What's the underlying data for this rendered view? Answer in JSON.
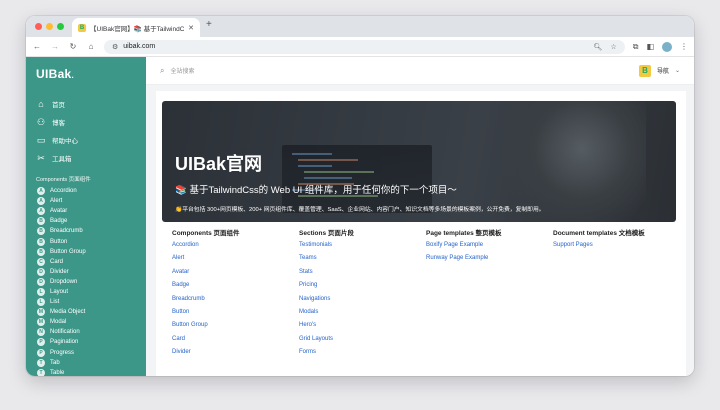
{
  "browser": {
    "tab_title": "【UIBak官网】📚 基于TailwindC",
    "tab_close": "✕",
    "new_tab": "+",
    "favicon_letter": "B",
    "url": "uibak.com"
  },
  "sidebar": {
    "logo": "UIBak",
    "menu": [
      {
        "label": "首页",
        "icon": "home-icon"
      },
      {
        "label": "博客",
        "icon": "users-icon"
      },
      {
        "label": "帮助中心",
        "icon": "folder-icon"
      },
      {
        "label": "工具箱",
        "icon": "tools-icon"
      }
    ],
    "section_label": "Components 页面组件",
    "components": [
      {
        "letter": "A",
        "label": "Accordion"
      },
      {
        "letter": "A",
        "label": "Alert"
      },
      {
        "letter": "A",
        "label": "Avatar"
      },
      {
        "letter": "B",
        "label": "Badge"
      },
      {
        "letter": "B",
        "label": "Breadcrumb"
      },
      {
        "letter": "B",
        "label": "Button"
      },
      {
        "letter": "B",
        "label": "Button Group"
      },
      {
        "letter": "C",
        "label": "Card"
      },
      {
        "letter": "D",
        "label": "Divider"
      },
      {
        "letter": "D",
        "label": "Dropdown"
      },
      {
        "letter": "L",
        "label": "Layout"
      },
      {
        "letter": "L",
        "label": "List"
      },
      {
        "letter": "M",
        "label": "Media Object"
      },
      {
        "letter": "M",
        "label": "Modal"
      },
      {
        "letter": "N",
        "label": "Notification"
      },
      {
        "letter": "P",
        "label": "Pagination"
      },
      {
        "letter": "P",
        "label": "Progress"
      },
      {
        "letter": "T",
        "label": "Tab"
      },
      {
        "letter": "T",
        "label": "Table"
      }
    ]
  },
  "topbar": {
    "search_placeholder": "全站搜索",
    "nav_label": "导航",
    "nav_favicon_letter": "B"
  },
  "hero": {
    "title": "UIBak官网",
    "subtitle": "📚 基于TailwindCss的 Web UI 组件库，用于任何你的下一个项目～",
    "description": "👏平台包括 300+网页模板、200+ 网页组件库、覆盖管理、SaaS、企业网站、内容门户、知识文档等多场景的模板案例，公开免费，复制即用。"
  },
  "columns": [
    {
      "heading": "Components 页面组件",
      "links": [
        "Accordion",
        "Alert",
        "Avatar",
        "Badge",
        "Breadcrumb",
        "Button",
        "Button Group",
        "Card",
        "Divider"
      ]
    },
    {
      "heading": "Sections 页面片段",
      "links": [
        "Testimonials",
        "Teams",
        "Stats",
        "Pricing",
        "Navigations",
        "Modals",
        "Hero's",
        "Grid Layouts",
        "Forms"
      ]
    },
    {
      "heading": "Page templates 整页模板",
      "links": [
        "Boxify Page Example",
        "Runway Page Example"
      ]
    },
    {
      "heading": "Document templates 文档模板",
      "links": [
        "Support Pages"
      ]
    }
  ],
  "colors": {
    "sidebar": "#3d9788",
    "link": "#2563c9"
  }
}
